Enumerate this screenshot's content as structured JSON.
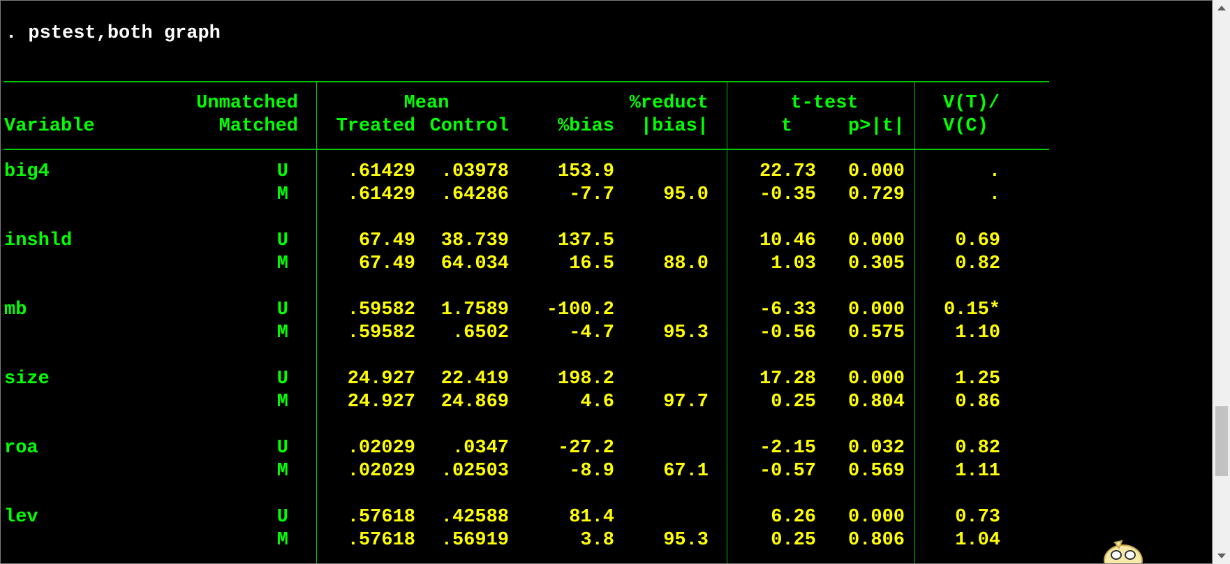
{
  "command": ". pstest,both graph",
  "header": {
    "variable": "Variable",
    "unmatched": "Unmatched",
    "matched": "Matched",
    "mean": "Mean",
    "treated": "Treated",
    "control": "Control",
    "bias": "%bias",
    "reduct": "%reduct",
    "abs_bias": "|bias|",
    "ttest": "t-test",
    "t": "t",
    "p": "p>|t|",
    "vt": "V(T)/",
    "vc": "V(C)"
  },
  "rows": [
    {
      "var": "big4",
      "type": "U",
      "treated": ".61429",
      "control": ".03978",
      "bias": "153.9",
      "reduct": "",
      "t": "22.73",
      "p": "0.000",
      "vratio": "."
    },
    {
      "var": "",
      "type": "M",
      "treated": ".61429",
      "control": ".64286",
      "bias": "-7.7",
      "reduct": "95.0",
      "t": "-0.35",
      "p": "0.729",
      "vratio": "."
    },
    {
      "var": "inshld",
      "type": "U",
      "treated": "67.49",
      "control": "38.739",
      "bias": "137.5",
      "reduct": "",
      "t": "10.46",
      "p": "0.000",
      "vratio": "0.69"
    },
    {
      "var": "",
      "type": "M",
      "treated": "67.49",
      "control": "64.034",
      "bias": "16.5",
      "reduct": "88.0",
      "t": "1.03",
      "p": "0.305",
      "vratio": "0.82"
    },
    {
      "var": "mb",
      "type": "U",
      "treated": ".59582",
      "control": "1.7589",
      "bias": "-100.2",
      "reduct": "",
      "t": "-6.33",
      "p": "0.000",
      "vratio": "0.15*"
    },
    {
      "var": "",
      "type": "M",
      "treated": ".59582",
      "control": ".6502",
      "bias": "-4.7",
      "reduct": "95.3",
      "t": "-0.56",
      "p": "0.575",
      "vratio": "1.10"
    },
    {
      "var": "size",
      "type": "U",
      "treated": "24.927",
      "control": "22.419",
      "bias": "198.2",
      "reduct": "",
      "t": "17.28",
      "p": "0.000",
      "vratio": "1.25"
    },
    {
      "var": "",
      "type": "M",
      "treated": "24.927",
      "control": "24.869",
      "bias": "4.6",
      "reduct": "97.7",
      "t": "0.25",
      "p": "0.804",
      "vratio": "0.86"
    },
    {
      "var": "roa",
      "type": "U",
      "treated": ".02029",
      "control": ".0347",
      "bias": "-27.2",
      "reduct": "",
      "t": "-2.15",
      "p": "0.032",
      "vratio": "0.82"
    },
    {
      "var": "",
      "type": "M",
      "treated": ".02029",
      "control": ".02503",
      "bias": "-8.9",
      "reduct": "67.1",
      "t": "-0.57",
      "p": "0.569",
      "vratio": "1.11"
    },
    {
      "var": "lev",
      "type": "U",
      "treated": ".57618",
      "control": ".42588",
      "bias": "81.4",
      "reduct": "",
      "t": "6.26",
      "p": "0.000",
      "vratio": "0.73"
    },
    {
      "var": "",
      "type": "M",
      "treated": ".57618",
      "control": ".56919",
      "bias": "3.8",
      "reduct": "95.3",
      "t": "0.25",
      "p": "0.806",
      "vratio": "1.04"
    }
  ],
  "colors": {
    "background": "#000000",
    "label": "#00ff00",
    "value": "#ffff00",
    "command": "#ffffff",
    "rule": "#00c800"
  },
  "icons": {
    "corner": "mascot-icon",
    "scroll_up": "arrow-up-icon",
    "scroll_down": "arrow-down-icon"
  }
}
